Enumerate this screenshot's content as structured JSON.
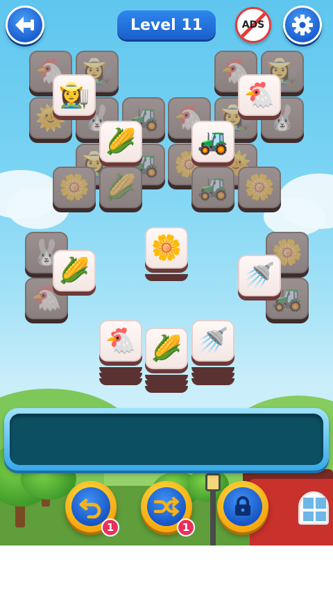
{
  "header": {
    "level_label": "Level 11",
    "ads_label": "ADS"
  },
  "icons": {
    "back": "back-arrow-icon",
    "settings": "gear-icon",
    "undo": "undo-icon",
    "shuffle": "shuffle-icon",
    "lock": "lock-icon"
  },
  "tile_symbols": {
    "chicken": "🐔",
    "farmer": "👩‍🌾",
    "sun": "🌞",
    "rabbit": "🐰",
    "tractor": "🚜",
    "corn": "🌽",
    "flower": "🌼",
    "watering_can": "🚿"
  },
  "powerups": {
    "undo_count": "1",
    "shuffle_count": "1"
  },
  "colors": {
    "button_blue": "#1b5fd0",
    "power_gold": "#f5a80e",
    "badge_red": "#e8305c",
    "tray_inner": "#0c4f63"
  }
}
